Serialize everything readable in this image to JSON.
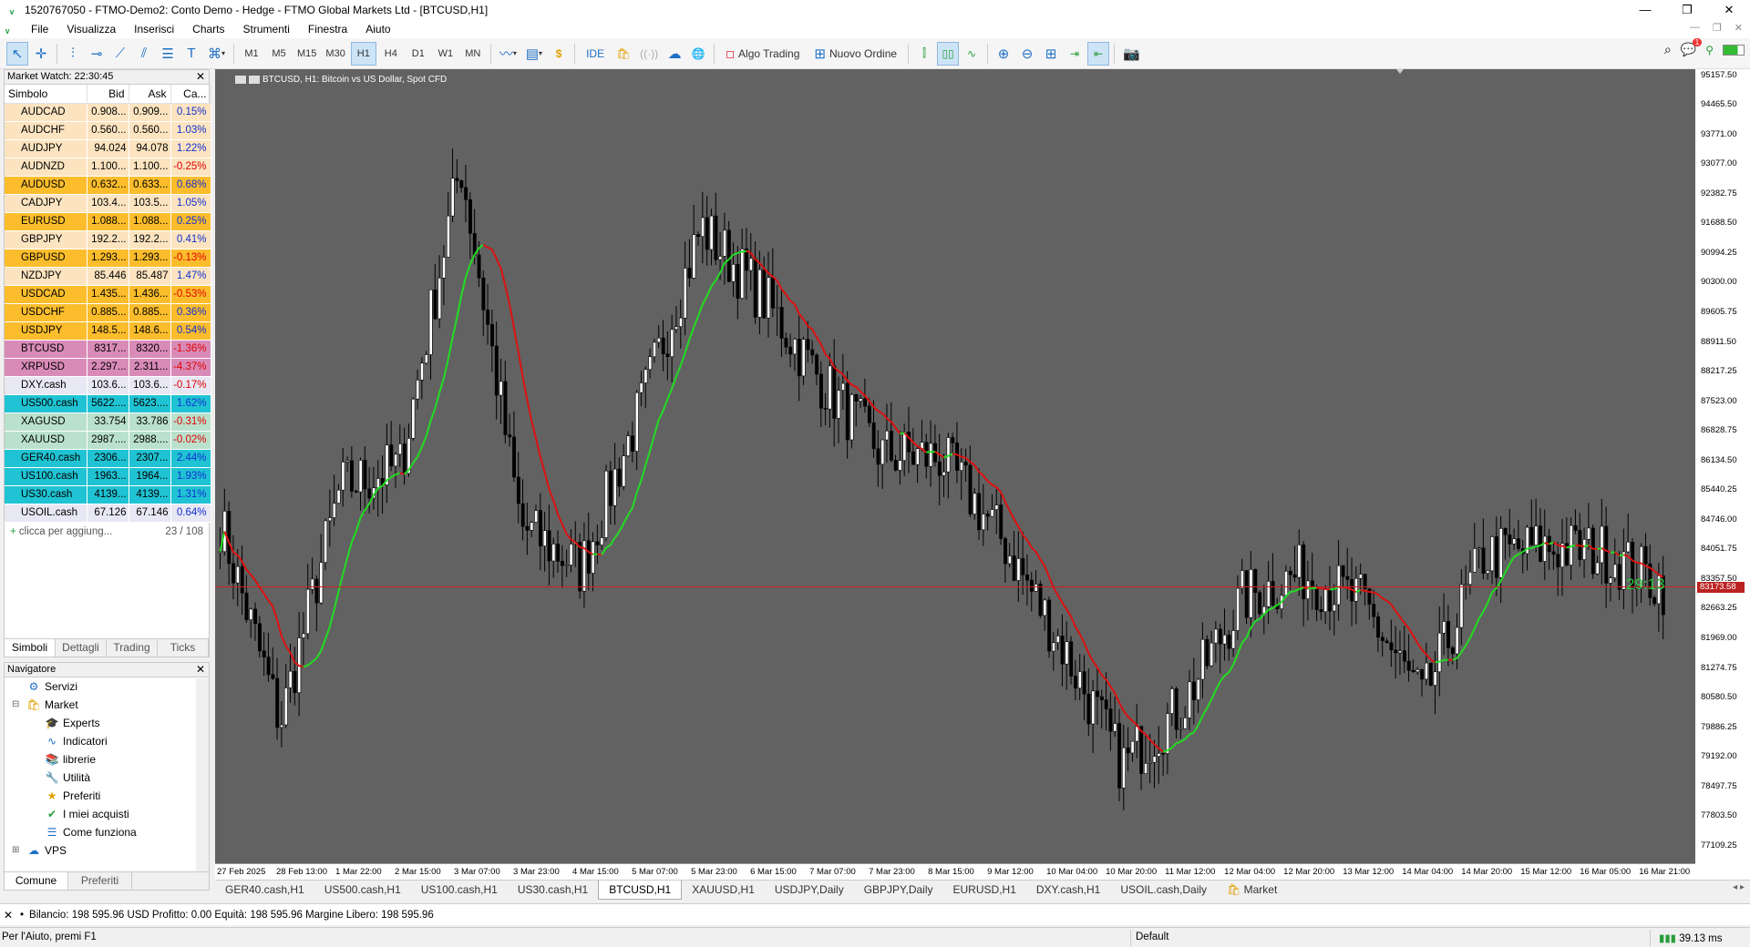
{
  "window": {
    "title": "1520767050 - FTMO-Demo2: Conto Demo - Hedge - FTMO Global Markets Ltd - [BTCUSD,H1]"
  },
  "menu": [
    "File",
    "Visualizza",
    "Inserisci",
    "Charts",
    "Strumenti",
    "Finestra",
    "Aiuto"
  ],
  "toolbar": {
    "timeframes": [
      "M1",
      "M5",
      "M15",
      "M30",
      "H1",
      "H4",
      "D1",
      "W1",
      "MN"
    ],
    "active_timeframe": "H1",
    "ide_label": "IDE",
    "algo_trading_label": "Algo Trading",
    "new_order_label": "Nuovo Ordine",
    "notification_count": "1"
  },
  "market_watch": {
    "title": "Market Watch: 22:30:45",
    "columns": [
      "Simbolo",
      "Bid",
      "Ask",
      "Ca..."
    ],
    "rows": [
      {
        "symbol": "AUDCAD",
        "bid": "0.908...",
        "ask": "0.909...",
        "change": "0.15%",
        "dir": "pos",
        "bg": "#fce4c0"
      },
      {
        "symbol": "AUDCHF",
        "bid": "0.560...",
        "ask": "0.560...",
        "change": "1.03%",
        "dir": "pos",
        "bg": "#fce4c0"
      },
      {
        "symbol": "AUDJPY",
        "bid": "94.024",
        "ask": "94.078",
        "change": "1.22%",
        "dir": "pos",
        "bg": "#fce4c0"
      },
      {
        "symbol": "AUDNZD",
        "bid": "1.100...",
        "ask": "1.100...",
        "change": "-0.25%",
        "dir": "neg",
        "bg": "#fce4c0"
      },
      {
        "symbol": "AUDUSD",
        "bid": "0.632...",
        "ask": "0.633...",
        "change": "0.68%",
        "dir": "pos",
        "bg": "#fbbd2c"
      },
      {
        "symbol": "CADJPY",
        "bid": "103.4...",
        "ask": "103.5...",
        "change": "1.05%",
        "dir": "pos",
        "bg": "#fce4c0"
      },
      {
        "symbol": "EURUSD",
        "bid": "1.088...",
        "ask": "1.088...",
        "change": "0.25%",
        "dir": "pos",
        "bg": "#fbbd2c"
      },
      {
        "symbol": "GBPJPY",
        "bid": "192.2...",
        "ask": "192.2...",
        "change": "0.41%",
        "dir": "pos",
        "bg": "#fce4c0"
      },
      {
        "symbol": "GBPUSD",
        "bid": "1.293...",
        "ask": "1.293...",
        "change": "-0.13%",
        "dir": "neg",
        "bg": "#fbbd2c"
      },
      {
        "symbol": "NZDJPY",
        "bid": "85.446",
        "ask": "85.487",
        "change": "1.47%",
        "dir": "pos",
        "bg": "#fce4c0"
      },
      {
        "symbol": "USDCAD",
        "bid": "1.435...",
        "ask": "1.436...",
        "change": "-0.53%",
        "dir": "neg",
        "bg": "#fbbd2c"
      },
      {
        "symbol": "USDCHF",
        "bid": "0.885...",
        "ask": "0.885...",
        "change": "0.36%",
        "dir": "pos",
        "bg": "#fbbd2c"
      },
      {
        "symbol": "USDJPY",
        "bid": "148.5...",
        "ask": "148.6...",
        "change": "0.54%",
        "dir": "pos",
        "bg": "#fbbd2c"
      },
      {
        "symbol": "BTCUSD",
        "bid": "8317...",
        "ask": "8320...",
        "change": "-1.36%",
        "dir": "neg",
        "bg": "#d98bb8"
      },
      {
        "symbol": "XRPUSD",
        "bid": "2.297...",
        "ask": "2.311...",
        "change": "-4.37%",
        "dir": "neg",
        "bg": "#d98bb8"
      },
      {
        "symbol": "DXY.cash",
        "bid": "103.6...",
        "ask": "103.6...",
        "change": "-0.17%",
        "dir": "neg",
        "bg": "#e8e8f4"
      },
      {
        "symbol": "US500.cash",
        "bid": "5622....",
        "ask": "5623....",
        "change": "1.62%",
        "dir": "pos",
        "bg": "#1fc3d3"
      },
      {
        "symbol": "XAGUSD",
        "bid": "33.754",
        "ask": "33.786",
        "change": "-0.31%",
        "dir": "neg",
        "bg": "#b9e1cc"
      },
      {
        "symbol": "XAUUSD",
        "bid": "2987....",
        "ask": "2988....",
        "change": "-0.02%",
        "dir": "neg",
        "bg": "#b9e1cc"
      },
      {
        "symbol": "GER40.cash",
        "bid": "2306...",
        "ask": "2307...",
        "change": "2.44%",
        "dir": "pos",
        "bg": "#1fc3d3"
      },
      {
        "symbol": "US100.cash",
        "bid": "1963...",
        "ask": "1964...",
        "change": "1.93%",
        "dir": "pos",
        "bg": "#1fc3d3"
      },
      {
        "symbol": "US30.cash",
        "bid": "4139...",
        "ask": "4139...",
        "change": "1.31%",
        "dir": "pos",
        "bg": "#1fc3d3"
      },
      {
        "symbol": "USOIL.cash",
        "bid": "67.126",
        "ask": "67.146",
        "change": "0.64%",
        "dir": "pos",
        "bg": "#e8e8f4"
      }
    ],
    "add_placeholder": "clicca per aggiung...",
    "count": "23 / 108",
    "tabs": [
      "Simboli",
      "Dettagli",
      "Trading",
      "Ticks"
    ]
  },
  "navigator": {
    "title": "Navigatore",
    "items": [
      {
        "label": "Servizi",
        "icon": "services-icon",
        "indent": 1
      },
      {
        "label": "Market",
        "icon": "market-icon",
        "indent": 1
      },
      {
        "label": "Experts",
        "icon": "experts-icon",
        "indent": 2
      },
      {
        "label": "Indicatori",
        "icon": "indicators-icon",
        "indent": 2
      },
      {
        "label": "librerie",
        "icon": "libraries-icon",
        "indent": 2
      },
      {
        "label": "Utilità",
        "icon": "utilities-icon",
        "indent": 2
      },
      {
        "label": "Preferiti",
        "icon": "star-icon",
        "indent": 2
      },
      {
        "label": "I miei acquisti",
        "icon": "purchases-icon",
        "indent": 2
      },
      {
        "label": "Come funziona",
        "icon": "list-icon",
        "indent": 2
      },
      {
        "label": "VPS",
        "icon": "vps-cloud-icon",
        "indent": 1
      }
    ],
    "tabs": [
      "Comune",
      "Preferiti"
    ]
  },
  "chart": {
    "title": "BTCUSD, H1:  Bitcoin vs US Dollar, Spot CFD",
    "y_labels": [
      "95157.50",
      "94465.50",
      "93771.00",
      "93077.00",
      "92382.75",
      "91688.50",
      "90994.25",
      "90300.00",
      "89605.75",
      "88911.50",
      "88217.25",
      "87523.00",
      "86828.75",
      "86134.50",
      "85440.25",
      "84746.00",
      "84051.75",
      "83357.50",
      "82663.25",
      "81969.00",
      "81274.75",
      "80580.50",
      "79886.25",
      "79192.00",
      "78497.75",
      "77803.50",
      "77109.25"
    ],
    "x_labels": [
      "27 Feb 2025",
      "28 Feb 13:00",
      "1 Mar 22:00",
      "2 Mar 15:00",
      "3 Mar 07:00",
      "3 Mar 23:00",
      "4 Mar 15:00",
      "5 Mar 07:00",
      "5 Mar 23:00",
      "6 Mar 15:00",
      "7 Mar 07:00",
      "7 Mar 23:00",
      "8 Mar 15:00",
      "9 Mar 12:00",
      "10 Mar 04:00",
      "10 Mar 20:00",
      "11 Mar 12:00",
      "12 Mar 04:00",
      "12 Mar 20:00",
      "13 Mar 12:00",
      "14 Mar 04:00",
      "14 Mar 20:00",
      "15 Mar 12:00",
      "16 Mar 05:00",
      "16 Mar 21:00"
    ],
    "bid_price": "83173.58",
    "bar_timer": "29:13",
    "colors": {
      "background": "#626262",
      "bull_ma": "#22dd22",
      "bear_ma": "#dd1111",
      "bid_line": "#cc2222"
    }
  },
  "chart_data": {
    "type": "line",
    "title": "BTCUSD, H1:  Bitcoin vs US Dollar, Spot CFD",
    "xlabel": "",
    "ylabel": "",
    "ylim": [
      76700,
      95300
    ],
    "x": [
      "27 Feb 2025",
      "28 Feb 13:00",
      "1 Mar 22:00",
      "2 Mar 15:00",
      "3 Mar 07:00",
      "3 Mar 23:00",
      "4 Mar 15:00",
      "5 Mar 07:00",
      "5 Mar 23:00",
      "6 Mar 15:00",
      "7 Mar 07:00",
      "7 Mar 23:00",
      "8 Mar 15:00",
      "9 Mar 12:00",
      "10 Mar 04:00",
      "10 Mar 20:00",
      "11 Mar 12:00",
      "12 Mar 04:00",
      "12 Mar 20:00",
      "13 Mar 12:00",
      "14 Mar 04:00",
      "14 Mar 20:00",
      "15 Mar 12:00",
      "16 Mar 05:00",
      "16 Mar 21:00"
    ],
    "series": [
      {
        "values": [
          84700,
          80000,
          85500,
          86000,
          93100,
          84600,
          83600,
          87400,
          91600,
          90000,
          88000,
          86300,
          86200,
          84300,
          81800,
          79000,
          80400,
          82900,
          83500,
          82800,
          80500,
          83900,
          84100,
          84000,
          83200
        ]
      }
    ],
    "bid_line": 83173.58,
    "grid": false
  },
  "chart_tabs": [
    "GER40.cash,H1",
    "US500.cash,H1",
    "US100.cash,H1",
    "US30.cash,H1",
    "BTCUSD,H1",
    "XAUUSD,H1",
    "USDJPY,Daily",
    "GBPJPY,Daily",
    "EURUSD,H1",
    "DXY.cash,H1",
    "USOIL.cash,Daily",
    "Market"
  ],
  "active_chart_tab": "BTCUSD,H1",
  "terminal": {
    "balance_line": "Bilancio: 198 595.96 USD  Profitto: 0.00  Equità: 198 595.96  Margine Libero: 198 595.96"
  },
  "status_bar": {
    "help": "Per l'Aiuto, premi F1",
    "profile": "Default",
    "ping": "39.13 ms"
  }
}
